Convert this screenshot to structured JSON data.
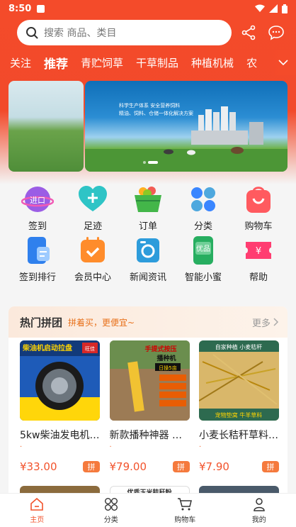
{
  "status": {
    "time": "8:50"
  },
  "search": {
    "placeholder": "搜索 商品、类目"
  },
  "tabs": [
    "关注",
    "推荐",
    "青贮饲草",
    "干草制品",
    "种植机械",
    "农"
  ],
  "banner": {
    "line1": "科学生产体系  安全营养饲料",
    "line2": "精油、饲料、仓储一体化解决方案"
  },
  "grid_row1": [
    "签到",
    "足迹",
    "订单",
    "分类",
    "购物车"
  ],
  "grid_row2": [
    "签到排行",
    "会员中心",
    "新闻资讯",
    "智能小蜜",
    "帮助"
  ],
  "icon_texts": {
    "checkin": "进口",
    "smart": "优品",
    "help": "¥"
  },
  "group": {
    "title": "热门拼团",
    "subtitle": "拼着买，更便宜~",
    "more": "更多"
  },
  "products": [
    {
      "name": "5kw柴油发电机…",
      "price": "¥33.00",
      "dot": "·",
      "img_text": "柴油机启动拉盘",
      "img_badge": "旺佳"
    },
    {
      "name": "新款播种神器 …",
      "price": "¥79.00",
      "dot": "·",
      "img_text": "手提式按压",
      "img_text2": "播种机",
      "img_badge": "日操5亩"
    },
    {
      "name": "小麦长秸秆草料…",
      "price": "¥7.90",
      "dot": "·",
      "img_text": "自家种植  小麦秸秆",
      "img_text2": "宠物垫窝  牛羊草料"
    }
  ],
  "pin_label": "拼",
  "peek_text": "优质玉米秸秆粉",
  "bottom_nav": [
    "主页",
    "分类",
    "购物车",
    "我的"
  ],
  "colors": {
    "brand": "#f44b2a",
    "price": "#f2532c",
    "pin": "#f57a3d"
  }
}
